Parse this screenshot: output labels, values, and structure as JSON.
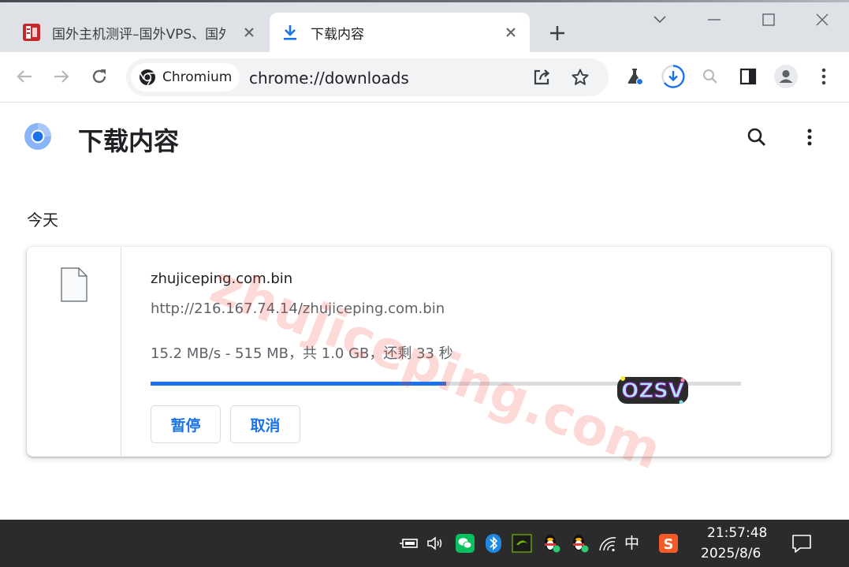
{
  "window": {
    "tabs": [
      {
        "title": "国外主机测评–国外VPS、国外",
        "active": false,
        "favicon": "site-logo-icon"
      },
      {
        "title": "下载内容",
        "active": true,
        "favicon": "download-icon"
      }
    ]
  },
  "toolbar": {
    "chip_label": "Chromium",
    "url": "chrome://downloads"
  },
  "page": {
    "title": "下载内容",
    "section_date": "今天"
  },
  "download": {
    "file_name": "zhujiceping.com.bin",
    "url": "http://216.167.74.14/zhujiceping.com.bin",
    "status": "15.2 MB/s - 515 MB，共 1.0 GB，还剩 33 秒",
    "progress": 0.5,
    "pause_label": "暂停",
    "cancel_label": "取消"
  },
  "watermark": "zhujiceping.com",
  "taskbar": {
    "ime_label": "中",
    "time": "21:57:48",
    "date": "2025/8/6"
  },
  "colors": {
    "accent": "#1a73e8",
    "tabstrip": "#dee1e6",
    "taskbar": "#2b2b2b"
  }
}
